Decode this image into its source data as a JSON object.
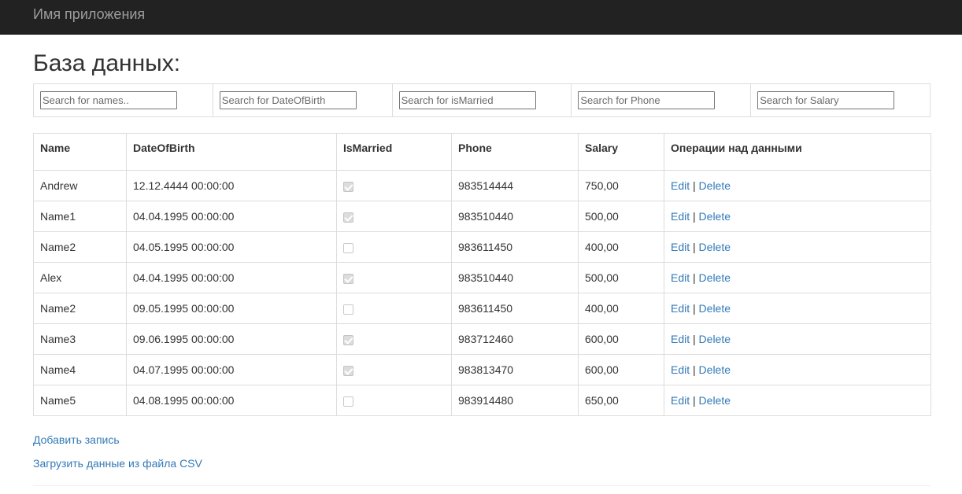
{
  "navbar": {
    "brand": "Имя приложения"
  },
  "page": {
    "title": "База данных:"
  },
  "search": {
    "names_placeholder": "Search for names..",
    "dob_placeholder": "Search for DateOfBirth",
    "married_placeholder": "Search for isMarried",
    "phone_placeholder": "Search for Phone",
    "salary_placeholder": "Search for Salary"
  },
  "table": {
    "headers": [
      "Name",
      "DateOfBirth",
      "IsMarried",
      "Phone",
      "Salary",
      "Операции над данными"
    ],
    "edit_label": "Edit",
    "separator": "|",
    "delete_label": "Delete",
    "rows": [
      {
        "name": "Andrew",
        "dob": "12.12.4444 00:00:00",
        "married": true,
        "phone": "983514444",
        "salary": "750,00"
      },
      {
        "name": "Name1",
        "dob": "04.04.1995 00:00:00",
        "married": true,
        "phone": "983510440",
        "salary": "500,00"
      },
      {
        "name": "Name2",
        "dob": "04.05.1995 00:00:00",
        "married": false,
        "phone": "983611450",
        "salary": "400,00"
      },
      {
        "name": "Alex",
        "dob": "04.04.1995 00:00:00",
        "married": true,
        "phone": "983510440",
        "salary": "500,00"
      },
      {
        "name": "Name2",
        "dob": "09.05.1995 00:00:00",
        "married": false,
        "phone": "983611450",
        "salary": "400,00"
      },
      {
        "name": "Name3",
        "dob": "09.06.1995 00:00:00",
        "married": true,
        "phone": "983712460",
        "salary": "600,00"
      },
      {
        "name": "Name4",
        "dob": "04.07.1995 00:00:00",
        "married": true,
        "phone": "983813470",
        "salary": "600,00"
      },
      {
        "name": "Name5",
        "dob": "04.08.1995 00:00:00",
        "married": false,
        "phone": "983914480",
        "salary": "650,00"
      }
    ]
  },
  "links": {
    "add_record": "Добавить запись",
    "load_csv": "Загрузить данные из файла CSV"
  },
  "colors": {
    "navbar_bg": "#222222",
    "brand_text": "#9d9d9d",
    "link": "#337ab7",
    "border": "#dddddd"
  }
}
